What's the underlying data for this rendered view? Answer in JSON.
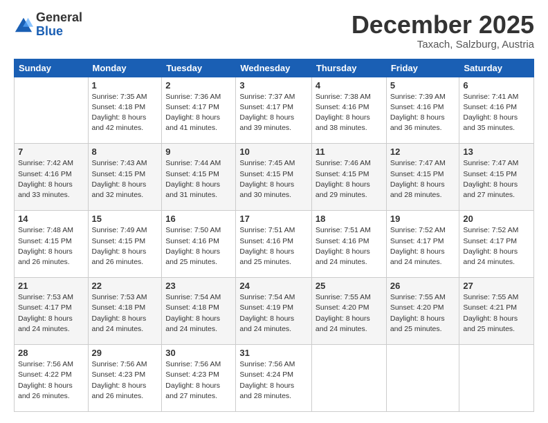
{
  "logo": {
    "general": "General",
    "blue": "Blue"
  },
  "header": {
    "month": "December 2025",
    "location": "Taxach, Salzburg, Austria"
  },
  "weekdays": [
    "Sunday",
    "Monday",
    "Tuesday",
    "Wednesday",
    "Thursday",
    "Friday",
    "Saturday"
  ],
  "weeks": [
    [
      {
        "day": "",
        "info": ""
      },
      {
        "day": "1",
        "info": "Sunrise: 7:35 AM\nSunset: 4:18 PM\nDaylight: 8 hours\nand 42 minutes."
      },
      {
        "day": "2",
        "info": "Sunrise: 7:36 AM\nSunset: 4:17 PM\nDaylight: 8 hours\nand 41 minutes."
      },
      {
        "day": "3",
        "info": "Sunrise: 7:37 AM\nSunset: 4:17 PM\nDaylight: 8 hours\nand 39 minutes."
      },
      {
        "day": "4",
        "info": "Sunrise: 7:38 AM\nSunset: 4:16 PM\nDaylight: 8 hours\nand 38 minutes."
      },
      {
        "day": "5",
        "info": "Sunrise: 7:39 AM\nSunset: 4:16 PM\nDaylight: 8 hours\nand 36 minutes."
      },
      {
        "day": "6",
        "info": "Sunrise: 7:41 AM\nSunset: 4:16 PM\nDaylight: 8 hours\nand 35 minutes."
      }
    ],
    [
      {
        "day": "7",
        "info": "Sunrise: 7:42 AM\nSunset: 4:16 PM\nDaylight: 8 hours\nand 33 minutes."
      },
      {
        "day": "8",
        "info": "Sunrise: 7:43 AM\nSunset: 4:15 PM\nDaylight: 8 hours\nand 32 minutes."
      },
      {
        "day": "9",
        "info": "Sunrise: 7:44 AM\nSunset: 4:15 PM\nDaylight: 8 hours\nand 31 minutes."
      },
      {
        "day": "10",
        "info": "Sunrise: 7:45 AM\nSunset: 4:15 PM\nDaylight: 8 hours\nand 30 minutes."
      },
      {
        "day": "11",
        "info": "Sunrise: 7:46 AM\nSunset: 4:15 PM\nDaylight: 8 hours\nand 29 minutes."
      },
      {
        "day": "12",
        "info": "Sunrise: 7:47 AM\nSunset: 4:15 PM\nDaylight: 8 hours\nand 28 minutes."
      },
      {
        "day": "13",
        "info": "Sunrise: 7:47 AM\nSunset: 4:15 PM\nDaylight: 8 hours\nand 27 minutes."
      }
    ],
    [
      {
        "day": "14",
        "info": "Sunrise: 7:48 AM\nSunset: 4:15 PM\nDaylight: 8 hours\nand 26 minutes."
      },
      {
        "day": "15",
        "info": "Sunrise: 7:49 AM\nSunset: 4:15 PM\nDaylight: 8 hours\nand 26 minutes."
      },
      {
        "day": "16",
        "info": "Sunrise: 7:50 AM\nSunset: 4:16 PM\nDaylight: 8 hours\nand 25 minutes."
      },
      {
        "day": "17",
        "info": "Sunrise: 7:51 AM\nSunset: 4:16 PM\nDaylight: 8 hours\nand 25 minutes."
      },
      {
        "day": "18",
        "info": "Sunrise: 7:51 AM\nSunset: 4:16 PM\nDaylight: 8 hours\nand 24 minutes."
      },
      {
        "day": "19",
        "info": "Sunrise: 7:52 AM\nSunset: 4:17 PM\nDaylight: 8 hours\nand 24 minutes."
      },
      {
        "day": "20",
        "info": "Sunrise: 7:52 AM\nSunset: 4:17 PM\nDaylight: 8 hours\nand 24 minutes."
      }
    ],
    [
      {
        "day": "21",
        "info": "Sunrise: 7:53 AM\nSunset: 4:17 PM\nDaylight: 8 hours\nand 24 minutes."
      },
      {
        "day": "22",
        "info": "Sunrise: 7:53 AM\nSunset: 4:18 PM\nDaylight: 8 hours\nand 24 minutes."
      },
      {
        "day": "23",
        "info": "Sunrise: 7:54 AM\nSunset: 4:18 PM\nDaylight: 8 hours\nand 24 minutes."
      },
      {
        "day": "24",
        "info": "Sunrise: 7:54 AM\nSunset: 4:19 PM\nDaylight: 8 hours\nand 24 minutes."
      },
      {
        "day": "25",
        "info": "Sunrise: 7:55 AM\nSunset: 4:20 PM\nDaylight: 8 hours\nand 24 minutes."
      },
      {
        "day": "26",
        "info": "Sunrise: 7:55 AM\nSunset: 4:20 PM\nDaylight: 8 hours\nand 25 minutes."
      },
      {
        "day": "27",
        "info": "Sunrise: 7:55 AM\nSunset: 4:21 PM\nDaylight: 8 hours\nand 25 minutes."
      }
    ],
    [
      {
        "day": "28",
        "info": "Sunrise: 7:56 AM\nSunset: 4:22 PM\nDaylight: 8 hours\nand 26 minutes."
      },
      {
        "day": "29",
        "info": "Sunrise: 7:56 AM\nSunset: 4:23 PM\nDaylight: 8 hours\nand 26 minutes."
      },
      {
        "day": "30",
        "info": "Sunrise: 7:56 AM\nSunset: 4:23 PM\nDaylight: 8 hours\nand 27 minutes."
      },
      {
        "day": "31",
        "info": "Sunrise: 7:56 AM\nSunset: 4:24 PM\nDaylight: 8 hours\nand 28 minutes."
      },
      {
        "day": "",
        "info": ""
      },
      {
        "day": "",
        "info": ""
      },
      {
        "day": "",
        "info": ""
      }
    ]
  ]
}
